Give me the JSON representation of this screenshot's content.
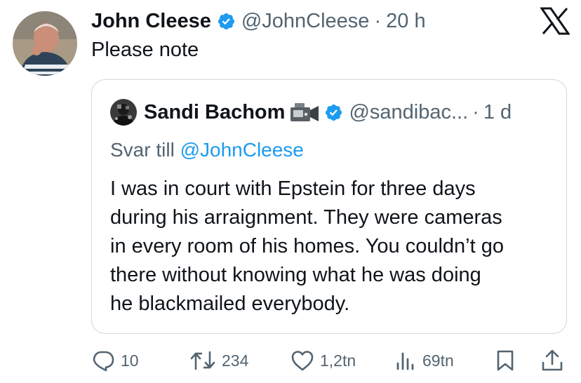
{
  "tweet": {
    "author_name": "John Cleese",
    "author_handle": "@JohnCleese",
    "separator": "·",
    "time": "20 h",
    "text": "Please note"
  },
  "quoted": {
    "author_name": "Sandi Bachom",
    "author_handle": "@sandibac...",
    "separator": "·",
    "time": "1 d",
    "reply_prefix": "Svar till ",
    "reply_mention": "@JohnCleese",
    "text": "I was in court with Epstein for three days\nduring his arraignment. They were cameras\nin every room of his homes. You couldn’t go\nthere without knowing what he was doing\nhe blackmailed everybody."
  },
  "actions": {
    "replies": "10",
    "reposts": "234",
    "likes": "1,2tn",
    "views": "69tn"
  },
  "colors": {
    "verified": "#1d9bf0",
    "mention": "#1d9bf0",
    "secondary_text": "#536471",
    "border": "#cfd9de"
  },
  "icons": [
    "verified-badge-icon",
    "x-logo-icon",
    "video-camera-emoji-icon",
    "reply-icon",
    "repost-icon",
    "like-icon",
    "views-icon",
    "bookmark-icon",
    "share-icon"
  ]
}
